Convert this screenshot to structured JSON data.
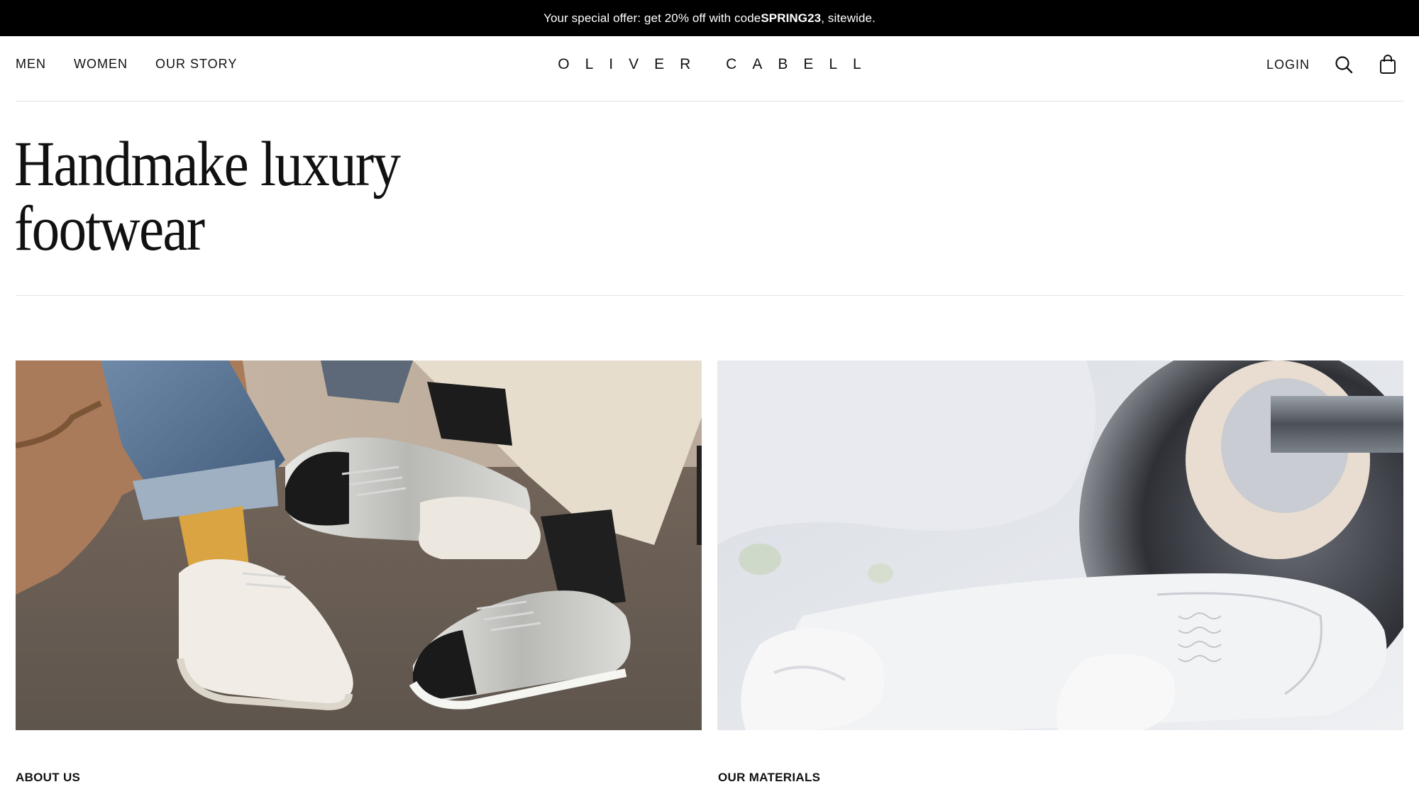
{
  "promo": {
    "text_before": "Your special offer: get 20% off with code ",
    "code": "SPRING23",
    "text_after": ", sitewide."
  },
  "nav": {
    "links": [
      "MEN",
      "WOMEN",
      "OUR STORY"
    ],
    "logo": "OLIVER CABELL",
    "login": "LOGIN",
    "icons": [
      "search-icon",
      "shopping-bag-icon"
    ]
  },
  "hero": {
    "headline_line1": "Handmake luxury",
    "headline_line2": "footwear"
  },
  "cards": [
    {
      "caption": "ABOUT US",
      "image": "sneakers-lifestyle-photo"
    },
    {
      "caption": "OUR MATERIALS",
      "image": "sole-polishing-photo"
    }
  ],
  "colors": {
    "promo_bg": "#000000",
    "text": "#111111",
    "divider": "#e2e2e2"
  }
}
